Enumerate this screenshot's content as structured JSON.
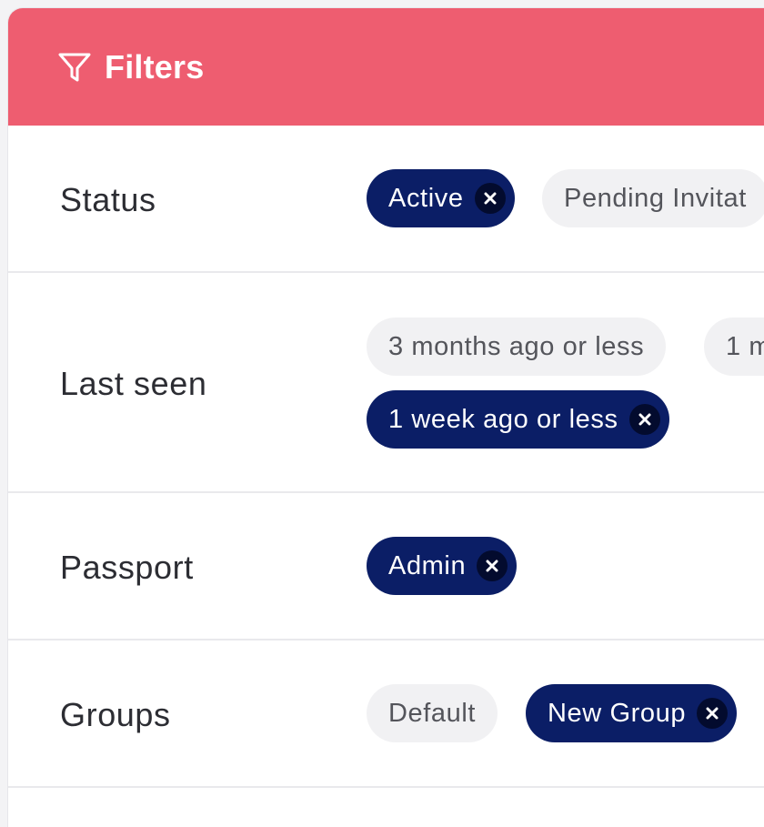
{
  "header": {
    "title": "Filters",
    "icon": "funnel-icon"
  },
  "filters": {
    "status": {
      "label": "Status",
      "chips": [
        {
          "text": "Active",
          "selected": true
        },
        {
          "text": "Pending Invitat",
          "selected": false
        }
      ]
    },
    "last_seen": {
      "label": "Last seen",
      "chips": [
        {
          "text": "3 months ago or less",
          "selected": false
        },
        {
          "text": "1 m",
          "selected": false
        },
        {
          "text": "1 week ago or less",
          "selected": true
        }
      ]
    },
    "passport": {
      "label": "Passport",
      "chips": [
        {
          "text": "Admin",
          "selected": true
        }
      ]
    },
    "groups": {
      "label": "Groups",
      "chips": [
        {
          "text": "Default",
          "selected": false
        },
        {
          "text": "New Group",
          "selected": true
        }
      ]
    }
  },
  "colors": {
    "header": "#ee5d70",
    "chip_selected": "#0b1e66",
    "chip_unselected": "#f1f1f3"
  }
}
